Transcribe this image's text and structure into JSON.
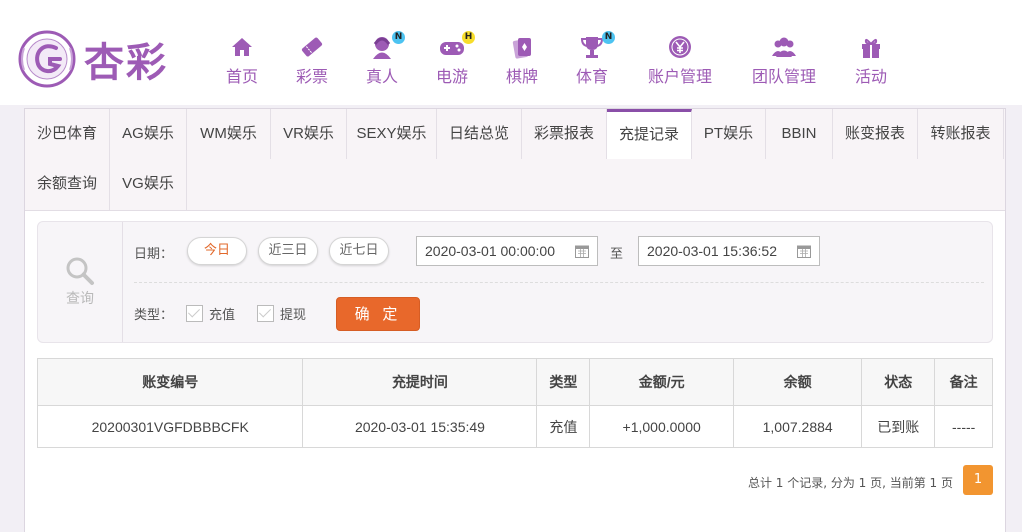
{
  "logo": {
    "text": "杏彩"
  },
  "nav": [
    {
      "label": "首页",
      "icon": "home-icon"
    },
    {
      "label": "彩票",
      "icon": "lottery-ticket-icon"
    },
    {
      "label": "真人",
      "icon": "live-dealer-icon",
      "badge": "N"
    },
    {
      "label": "电游",
      "icon": "gamepad-icon",
      "badge": "H"
    },
    {
      "label": "棋牌",
      "icon": "playing-cards-icon"
    },
    {
      "label": "体育",
      "icon": "trophy-icon",
      "badge": "N"
    },
    {
      "label": "账户管理",
      "icon": "yen-coin-icon"
    },
    {
      "label": "团队管理",
      "icon": "team-icon"
    },
    {
      "label": "活动",
      "icon": "gift-icon"
    }
  ],
  "tabs": [
    "沙巴体育",
    "AG娱乐",
    "WM娱乐",
    "VR娱乐",
    "SEXY娱乐",
    "日结总览",
    "彩票报表",
    "充提记录",
    "PT娱乐",
    "BBIN",
    "账变报表",
    "转账报表",
    "余额查询",
    "VG娱乐"
  ],
  "active_tab": "充提记录",
  "search": {
    "section_label": "查询",
    "date_label": "日期：",
    "quick_ranges": [
      "今日",
      "近三日",
      "近七日"
    ],
    "start_date": "2020-03-01 00:00:00",
    "to_label": "至",
    "end_date": "2020-03-01 15:36:52",
    "type_label": "类型：",
    "types": [
      "充值",
      "提现"
    ],
    "confirm_label": "确 定"
  },
  "table": {
    "headers": [
      "账变编号",
      "充提时间",
      "类型",
      "金额/元",
      "余额",
      "状态",
      "备注"
    ],
    "rows": [
      [
        "20200301VGFDBBBCFK",
        "2020-03-01 15:35:49",
        "充值",
        "+1,000.0000",
        "1,007.2884",
        "已到账",
        "-----"
      ]
    ]
  },
  "pager": {
    "summary": "总计 1 个记录, 分为 1 页, 当前第 1 页",
    "current_page": "1"
  },
  "colors": {
    "brand": "#9d5bb5",
    "accent": "#e8682b",
    "page_button": "#f29530",
    "amount": "#c7201d",
    "status_ok": "#3a9a2a"
  }
}
